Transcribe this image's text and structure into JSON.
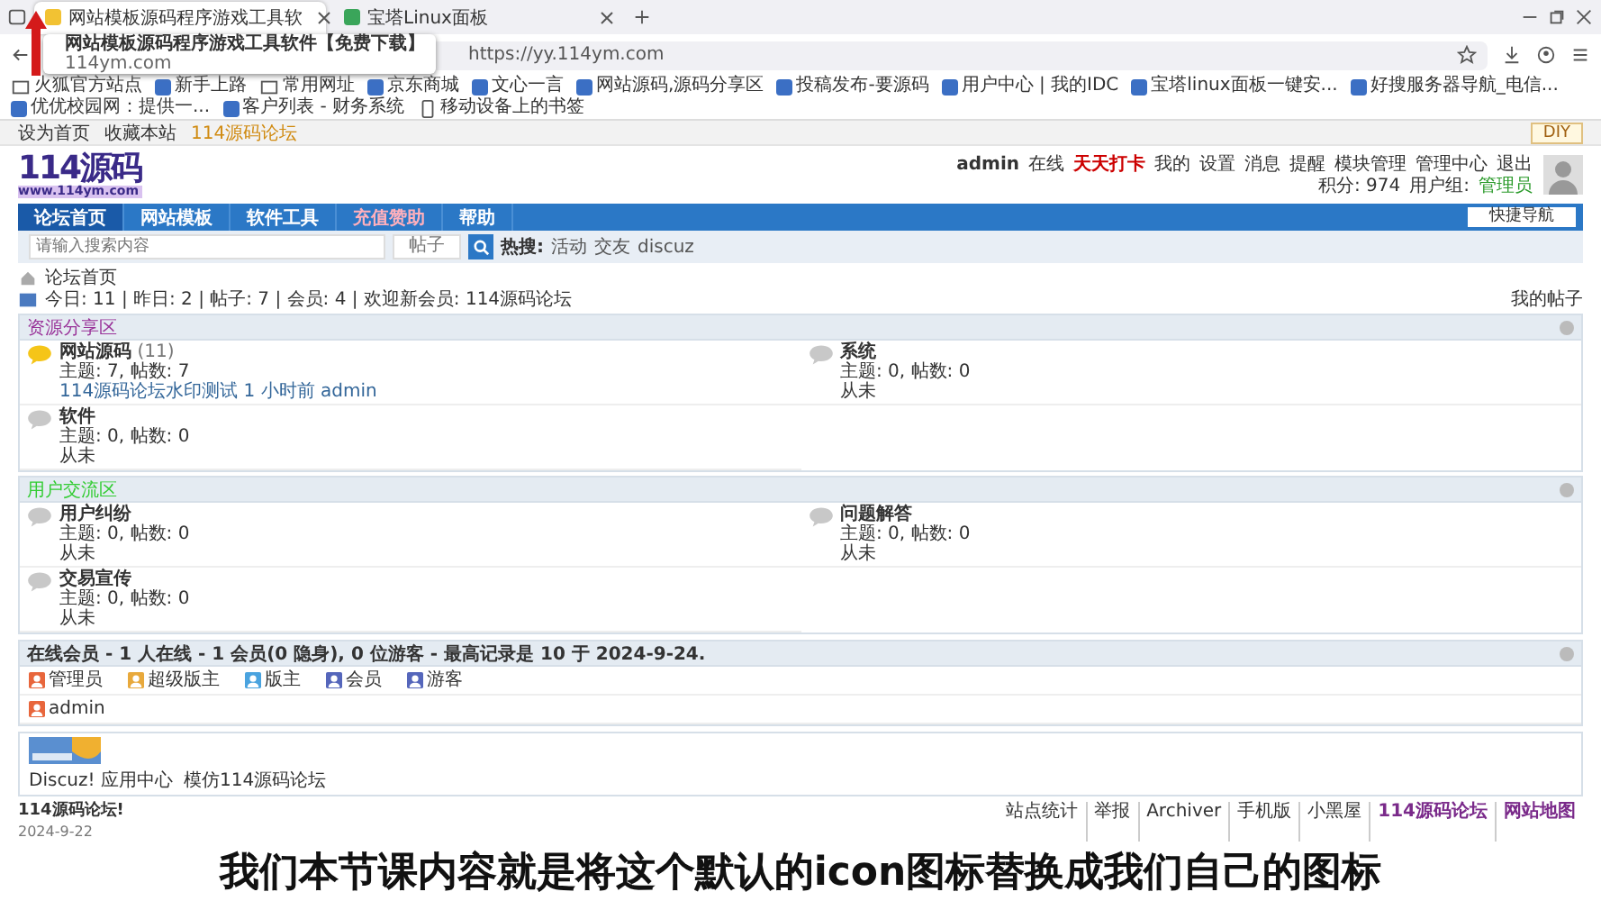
{
  "browser": {
    "tabs": [
      {
        "title": "网站模板源码程序游戏工具软",
        "selected": true
      },
      {
        "title": "宝塔Linux面板",
        "selected": false
      }
    ],
    "tooltip": {
      "title": "网站模板源码程序游戏工具软件【免费下载】",
      "host": "114ym.com"
    },
    "address": "https://yy.114ym.com",
    "bookmarks": [
      {
        "label": "火狐官方站点",
        "kind": "folder"
      },
      {
        "label": "新手上路",
        "kind": "site"
      },
      {
        "label": "常用网址",
        "kind": "folder"
      },
      {
        "label": "京东商城",
        "kind": "site"
      },
      {
        "label": "文心一言",
        "kind": "site"
      },
      {
        "label": "网站源码,源码分享区",
        "kind": "site"
      },
      {
        "label": "投稿发布-要源码",
        "kind": "site"
      },
      {
        "label": "用户中心 | 我的IDC",
        "kind": "site"
      },
      {
        "label": "宝塔linux面板一键安...",
        "kind": "site"
      },
      {
        "label": "好搜服务器导航_电信...",
        "kind": "site"
      },
      {
        "label": "优优校园网：提供一...",
        "kind": "site"
      },
      {
        "label": "客户列表 - 财务系统",
        "kind": "site"
      }
    ],
    "mobile_bookmarks": "移动设备上的书签"
  },
  "topbar": {
    "links": [
      "设为首页",
      "收藏本站"
    ],
    "site": "114源码论坛",
    "diy": "DIY"
  },
  "header": {
    "logo": "114源码",
    "logo_sub": "www.114ym.com",
    "user": "admin",
    "status": "在线",
    "checkin": "天天打卡",
    "menu": [
      "我的",
      "设置",
      "消息",
      "提醒",
      "模块管理",
      "管理中心",
      "退出"
    ],
    "points": "积分: 974",
    "group_label": "用户组:",
    "group": "管理员"
  },
  "nav": {
    "items": [
      {
        "label": "论坛首页",
        "selected": true,
        "kind": "normal"
      },
      {
        "label": "网站模板",
        "selected": false,
        "kind": "normal"
      },
      {
        "label": "软件工具",
        "selected": false,
        "kind": "normal"
      },
      {
        "label": "充值赞助",
        "selected": false,
        "kind": "highlight"
      },
      {
        "label": "帮助",
        "selected": false,
        "kind": "normal"
      }
    ],
    "quick_nav": "快捷导航"
  },
  "search": {
    "placeholder": "请输入搜索内容",
    "scope": "帖子",
    "hot_label": "热搜:",
    "hot": [
      "活动",
      "交友",
      "discuz"
    ]
  },
  "breadcrumb": "论坛首页",
  "stats": {
    "text": "今日: 11 | 昨日: 2 | 帖子: 7 | 会员: 4 | 欢迎新会员: 114源码论坛",
    "my_posts": "我的帖子"
  },
  "sections": [
    {
      "title": "资源分享区",
      "color": "#993399",
      "forums": [
        {
          "name": "网站源码",
          "count": "(11)",
          "has_new": true,
          "stats": "主题: 7, 帖数: 7",
          "last": "114源码论坛水印测试 1 小时前 admin"
        },
        {
          "name": "系统",
          "has_new": false,
          "stats": "主题: 0, 帖数: 0",
          "last": "从未"
        },
        {
          "name": "软件",
          "has_new": false,
          "stats": "主题: 0, 帖数: 0",
          "last": "从未"
        }
      ]
    },
    {
      "title": "用户交流区",
      "color": "#33cc33",
      "forums": [
        {
          "name": "用户纠纷",
          "has_new": false,
          "stats": "主题: 0, 帖数: 0",
          "last": "从未"
        },
        {
          "name": "问题解答",
          "has_new": false,
          "stats": "主题: 0, 帖数: 0",
          "last": "从未"
        },
        {
          "name": "交易宣传",
          "has_new": false,
          "stats": "主题: 0, 帖数: 0",
          "last": "从未"
        }
      ]
    }
  ],
  "online": {
    "title": "在线会员 - 1 人在线 - 1 会员(0 隐身), 0 位游客 - 最高记录是 10 于 2024-9-24.",
    "legend": [
      {
        "label": "管理员",
        "color": "#e8663c"
      },
      {
        "label": "超级版主",
        "color": "#e8a93c"
      },
      {
        "label": "版主",
        "color": "#4aa3df"
      },
      {
        "label": "会员",
        "color": "#5566bb"
      },
      {
        "label": "游客",
        "color": "#5566bb"
      }
    ],
    "users": [
      "admin"
    ]
  },
  "links": {
    "items": [
      "Discuz! 应用中心",
      "模仿114源码论坛"
    ]
  },
  "footer": {
    "site": "114源码论坛!",
    "date": "2024-9-22",
    "links": [
      {
        "label": "站点统计",
        "bold": false
      },
      {
        "label": "举报",
        "bold": false
      },
      {
        "label": "Archiver",
        "bold": false
      },
      {
        "label": "手机版",
        "bold": false
      },
      {
        "label": "小黑屋",
        "bold": false
      },
      {
        "label": "114源码论坛",
        "bold": true
      },
      {
        "label": "网站地图",
        "bold": true
      }
    ]
  },
  "caption": "我们本节课内容就是将这个默认的icon图标替换成我们自己的图标"
}
